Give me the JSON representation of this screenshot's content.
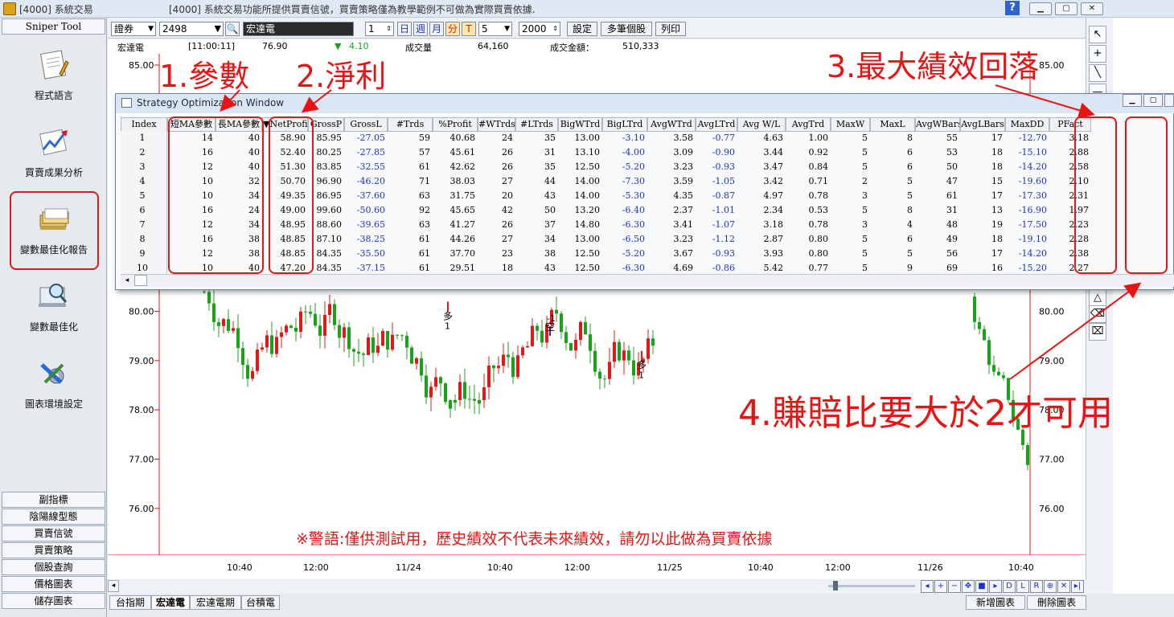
{
  "window": {
    "title": "[4000] 系統交易",
    "notice": "[4000] 系統交易功能所提供買賣信號，買賣策略僅為教學範例不可做為實際買賣依據.",
    "help": "?"
  },
  "sidebar": {
    "header": "Sniper Tool",
    "items": [
      {
        "label": "程式語言",
        "icon": "notepad-pencil-icon"
      },
      {
        "label": "買賣成果分析",
        "icon": "chart-arrow-icon"
      },
      {
        "label": "變數最佳化報告",
        "icon": "folders-report-icon"
      },
      {
        "label": "變數最佳化",
        "icon": "magnifier-monitor-icon"
      },
      {
        "label": "圖表環境設定",
        "icon": "tools-gear-icon"
      }
    ],
    "buttons": [
      "副指標",
      "陰陽線型態",
      "買賣信號",
      "買賣策略",
      "個股查詢",
      "價格圖表",
      "儲存圖表"
    ]
  },
  "toolbar": {
    "market": "證券",
    "stock_code": "2498",
    "stock_name": "宏達電",
    "period_value": "1",
    "period_units": [
      "日",
      "週",
      "月",
      "分",
      "T"
    ],
    "interval": "5",
    "bars": "2000",
    "buttons": [
      "設定",
      "多筆個股",
      "列印"
    ]
  },
  "infobar": {
    "name": "宏達電",
    "time": "[11:00:11]",
    "price": "76.90",
    "change_arrow": "▼",
    "change": "4.10",
    "volume_label": "成交量",
    "volume": "64,160",
    "amount_label": "成交金額：",
    "amount": "510,333"
  },
  "chart_data": {
    "type": "candlestick",
    "y_ticks": [
      "85.00",
      "80.00",
      "79.00",
      "78.00",
      "77.00",
      "76.00"
    ],
    "x_ticks": [
      "10:40",
      "12:00",
      "11/24",
      "10:40",
      "12:00",
      "11/25",
      "10:40",
      "12:00",
      "11/26",
      "10:40"
    ],
    "signals": [
      {
        "label": "多",
        "qty": "1",
        "color": "#e01818"
      },
      {
        "label": "空",
        "qty": "-1",
        "color": "#1b33c8"
      },
      {
        "label": "多",
        "qty": "1",
        "color": "#e01818"
      }
    ],
    "up_color": "#e01818",
    "down_color": "#1aa31a"
  },
  "optimization_window": {
    "title": "Strategy Optimization Window",
    "columns": [
      "Index",
      "短MA參數",
      "長MA參數",
      "▼NetProfit",
      "GrossP",
      "GrossL",
      "#Trds",
      "%Profit",
      "#WTrds",
      "#LTrds",
      "BigWTrd",
      "BigLTrd",
      "AvgWTrd",
      "AvgLTrd",
      "Avg W/L",
      "AvgTrd",
      "MaxW",
      "MaxL",
      "AvgWBars",
      "AvgLBars",
      "MaxDD",
      "PFact"
    ],
    "rows": [
      [
        "1",
        "14",
        "40",
        "58.90",
        "85.95",
        "-27.05",
        "59",
        "40.68",
        "24",
        "35",
        "13.00",
        "-3.10",
        "3.58",
        "-0.77",
        "4.63",
        "1.00",
        "5",
        "8",
        "55",
        "17",
        "-12.70",
        "3.18"
      ],
      [
        "2",
        "16",
        "40",
        "52.40",
        "80.25",
        "-27.85",
        "57",
        "45.61",
        "26",
        "31",
        "13.10",
        "-4.00",
        "3.09",
        "-0.90",
        "3.44",
        "0.92",
        "5",
        "6",
        "53",
        "18",
        "-15.10",
        "2.88"
      ],
      [
        "3",
        "12",
        "40",
        "51.30",
        "83.85",
        "-32.55",
        "61",
        "42.62",
        "26",
        "35",
        "12.50",
        "-5.20",
        "3.23",
        "-0.93",
        "3.47",
        "0.84",
        "5",
        "6",
        "50",
        "18",
        "-14.20",
        "2.58"
      ],
      [
        "4",
        "10",
        "32",
        "50.70",
        "96.90",
        "-46.20",
        "71",
        "38.03",
        "27",
        "44",
        "14.00",
        "-7.30",
        "3.59",
        "-1.05",
        "3.42",
        "0.71",
        "2",
        "5",
        "47",
        "15",
        "-19.60",
        "2.10"
      ],
      [
        "5",
        "10",
        "34",
        "49.35",
        "86.95",
        "-37.60",
        "63",
        "31.75",
        "20",
        "43",
        "14.00",
        "-5.30",
        "4.35",
        "-0.87",
        "4.97",
        "0.78",
        "3",
        "5",
        "61",
        "17",
        "-17.30",
        "2.31"
      ],
      [
        "6",
        "16",
        "24",
        "49.00",
        "99.60",
        "-50.60",
        "92",
        "45.65",
        "42",
        "50",
        "13.20",
        "-6.40",
        "2.37",
        "-1.01",
        "2.34",
        "0.53",
        "5",
        "8",
        "31",
        "13",
        "-16.90",
        "1.97"
      ],
      [
        "7",
        "12",
        "34",
        "48.95",
        "88.60",
        "-39.65",
        "63",
        "41.27",
        "26",
        "37",
        "14.80",
        "-6.30",
        "3.41",
        "-1.07",
        "3.18",
        "0.78",
        "3",
        "4",
        "48",
        "19",
        "-17.50",
        "2.23"
      ],
      [
        "8",
        "16",
        "38",
        "48.85",
        "87.10",
        "-38.25",
        "61",
        "44.26",
        "27",
        "34",
        "13.00",
        "-6.50",
        "3.23",
        "-1.12",
        "2.87",
        "0.80",
        "5",
        "6",
        "49",
        "18",
        "-19.10",
        "2.28"
      ],
      [
        "9",
        "12",
        "38",
        "48.85",
        "84.35",
        "-35.50",
        "61",
        "37.70",
        "23",
        "38",
        "12.50",
        "-5.20",
        "3.67",
        "-0.93",
        "3.93",
        "0.80",
        "5",
        "5",
        "56",
        "17",
        "-14.20",
        "2.38"
      ],
      [
        "10",
        "10",
        "40",
        "47.20",
        "84.35",
        "-37.15",
        "61",
        "29.51",
        "18",
        "43",
        "12.50",
        "-6.30",
        "4.69",
        "-0.86",
        "5.42",
        "0.77",
        "5",
        "9",
        "69",
        "16",
        "-15.20",
        "2.27"
      ]
    ]
  },
  "annotations": {
    "params": "1.參數",
    "net_profit": "2.淨利",
    "max_dd": "3.最大績效回落",
    "pfact": "4.賺賠比要大於2才可用",
    "warning": "※警語:僅供測試用，歷史績效不代表未來績效，請勿以此做為買賣依據"
  },
  "bottom_controls": [
    "◂",
    "+",
    "−",
    "✥",
    "■",
    "▸",
    "D",
    "L",
    "R",
    "⊕",
    "✕",
    "▸|"
  ],
  "chart_tabs": [
    "台指期",
    "宏達電",
    "宏達電期",
    "台積電"
  ],
  "chart_tabs_active": 1,
  "right_buttons": [
    "新增圖表",
    "刪除圖表"
  ],
  "colors": {
    "accent_red": "#e01818",
    "negative_blue": "#1b33c8"
  }
}
